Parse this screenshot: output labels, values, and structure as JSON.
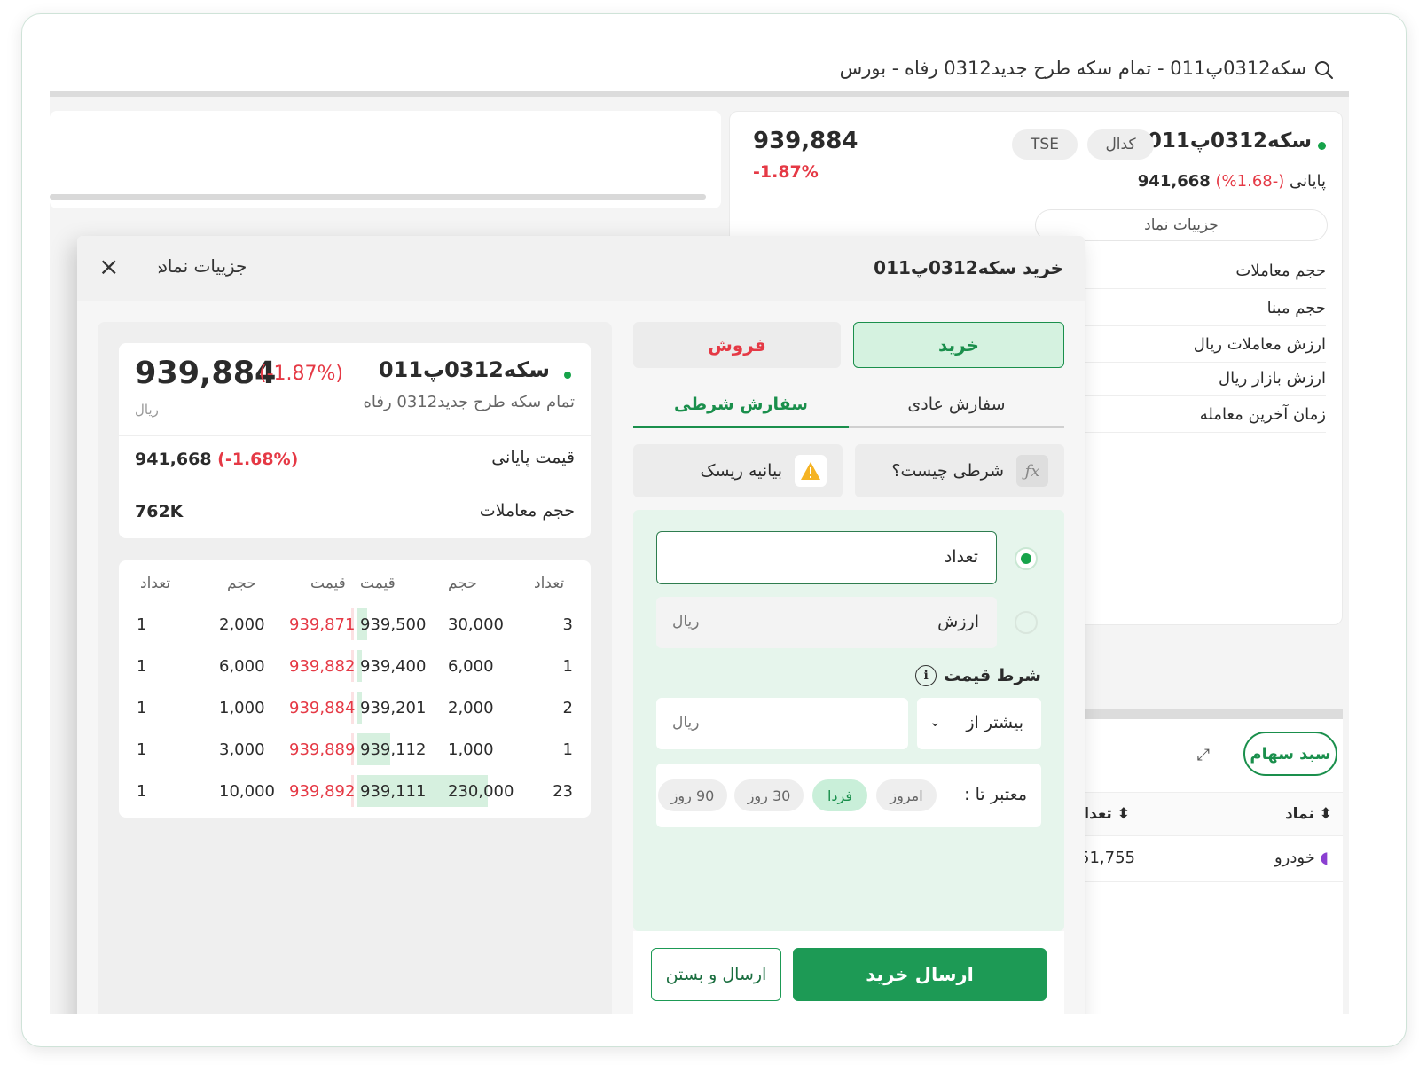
{
  "search": {
    "text": "سکه0312پ011 - تمام سکه طرح جدید0312 رفاه - بورس"
  },
  "background_info": {
    "symbol": "سکه0312پ011",
    "badge_market": "TSE",
    "badge_broker": "کدال",
    "last_price": "939,884",
    "last_change": "-1.87%",
    "closing_label": "پایانی",
    "closing_price": "941,668",
    "closing_change": "(-1.68%)",
    "details_button": "جزییات نماد",
    "rows": [
      "حجم معاملات",
      "حجم مبنا",
      "ارزش معاملات ریال",
      "ارزش بازار ریال",
      "زمان آخرین معامله"
    ]
  },
  "portfolio": {
    "basket_button": "سبد سهام",
    "col_symbol": "نماد",
    "col_count": "تعداد",
    "row_symbol": "خودرو",
    "row_count": "51,755"
  },
  "modal": {
    "title": "خرید سکه0312پ011",
    "details_link": "جزییات نماد",
    "close_icon": "close-icon"
  },
  "summary": {
    "symbol": "سکه0312پ011",
    "full_name": "تمام سکه طرح جدید0312 رفاه",
    "price": "939,884",
    "change": "(-1.87%)",
    "unit": "ریال",
    "closing_label": "قیمت پایانی",
    "closing_value": "941,668",
    "closing_change": "(-1.68%)",
    "volume_label": "حجم معاملات",
    "volume_value": "762K"
  },
  "order_book": {
    "headers": [
      "تعداد",
      "حجم",
      "قیمت",
      "قیمت",
      "حجم",
      "تعداد"
    ],
    "rows": [
      {
        "sell_count": "1",
        "sell_volume": "2,000",
        "sell_price": "939,871",
        "buy_price": "939,500",
        "buy_volume": "30,000",
        "buy_count": "3",
        "buy_depth": 0.08,
        "sell_depth": 0.02
      },
      {
        "sell_count": "1",
        "sell_volume": "6,000",
        "sell_price": "939,882",
        "buy_price": "939,400",
        "buy_volume": "6,000",
        "buy_count": "1",
        "buy_depth": 0.02,
        "sell_depth": 0.01
      },
      {
        "sell_count": "1",
        "sell_volume": "1,000",
        "sell_price": "939,884",
        "buy_price": "939,201",
        "buy_volume": "2,000",
        "buy_count": "2",
        "buy_depth": 0.01,
        "sell_depth": 0.01
      },
      {
        "sell_count": "1",
        "sell_volume": "3,000",
        "sell_price": "939,889",
        "buy_price": "939,112",
        "buy_volume": "1,000",
        "buy_count": "1",
        "buy_depth": 0.26,
        "sell_depth": 0.01
      },
      {
        "sell_count": "1",
        "sell_volume": "10,000",
        "sell_price": "939,892",
        "buy_price": "939,111",
        "buy_volume": "230,000",
        "buy_count": "23",
        "buy_depth": 1.0,
        "sell_depth": 0.03
      }
    ]
  },
  "order_form": {
    "buy_tab": "خرید",
    "sell_tab": "فروش",
    "normal_order_tab": "سفارش عادی",
    "conditional_order_tab": "سفارش شرطی",
    "what_is_conditional": "شرطی چیست؟",
    "risk_statement": "بیانیه ریسک",
    "quantity_placeholder": "تعداد",
    "value_placeholder": "ارزش",
    "value_unit": "ریال",
    "price_condition_label": "شرط قیمت",
    "condition_operator": "بیشتر از",
    "price_unit": "ریال",
    "valid_until_label": "معتبر تا :",
    "validity_options": [
      "امروز",
      "فردا",
      "30 روز",
      "90 روز"
    ],
    "selected_validity": "فردا",
    "submit_buy": "ارسال خرید",
    "submit_and_close": "ارسال و بستن"
  },
  "colors": {
    "accent_green": "#1d9a55",
    "negative_red": "#e53945",
    "form_bg": "#e6f5ec"
  }
}
